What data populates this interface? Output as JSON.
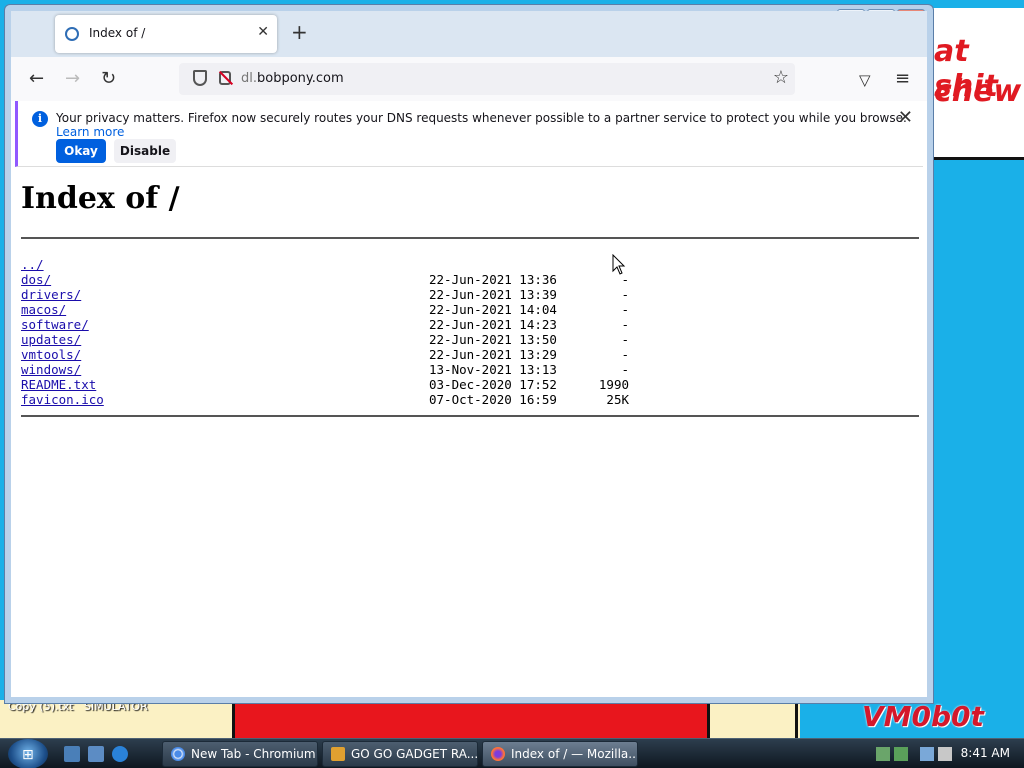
{
  "browser": {
    "tab_title": "Index of /",
    "tab_close_glyph": "✕",
    "new_tab_glyph": "+",
    "url_subdomain": "dl.",
    "url_domain": "bobpony.com",
    "window_minimize_glyph": "—",
    "window_maximize_glyph": "❐",
    "window_close_glyph": "✕"
  },
  "notice": {
    "text": "Your privacy matters. Firefox now securely routes your DNS requests whenever possible to a partner service to protect you while you browse.",
    "learn_more": "Learn more",
    "okay": "Okay",
    "disable": "Disable"
  },
  "page": {
    "heading": "Index of /",
    "entries": [
      {
        "name": "../",
        "date": "",
        "size": ""
      },
      {
        "name": "dos/",
        "date": "22-Jun-2021 13:36",
        "size": "-"
      },
      {
        "name": "drivers/",
        "date": "22-Jun-2021 13:39",
        "size": "-"
      },
      {
        "name": "macos/",
        "date": "22-Jun-2021 14:04",
        "size": "-"
      },
      {
        "name": "software/",
        "date": "22-Jun-2021 14:23",
        "size": "-"
      },
      {
        "name": "updates/",
        "date": "22-Jun-2021 13:50",
        "size": "-"
      },
      {
        "name": "vmtools/",
        "date": "22-Jun-2021 13:29",
        "size": "-"
      },
      {
        "name": "windows/",
        "date": "13-Nov-2021 13:13",
        "size": "-"
      },
      {
        "name": "README.txt",
        "date": "03-Dec-2020 17:52",
        "size": "1990"
      },
      {
        "name": "favicon.ico",
        "date": "07-Oct-2020 16:59",
        "size": "25K"
      }
    ]
  },
  "desktop": {
    "wall_line1": "at shit",
    "wall_line2": "chew",
    "label_copy": "Copy (5).txt",
    "label_sim": "SIMULATOR",
    "watermark": "VM0b0t"
  },
  "taskbar": {
    "tasks": [
      {
        "label": "New Tab - Chromium"
      },
      {
        "label": "GO GO GADGET RA..."
      },
      {
        "label": "Index of / — Mozilla..."
      }
    ],
    "clock": "8:41 AM"
  },
  "colors": {
    "accent": "#0060df",
    "link": "#1a0dab",
    "desktop_blue": "#1ab0e8",
    "wall_red": "#e8161d"
  }
}
